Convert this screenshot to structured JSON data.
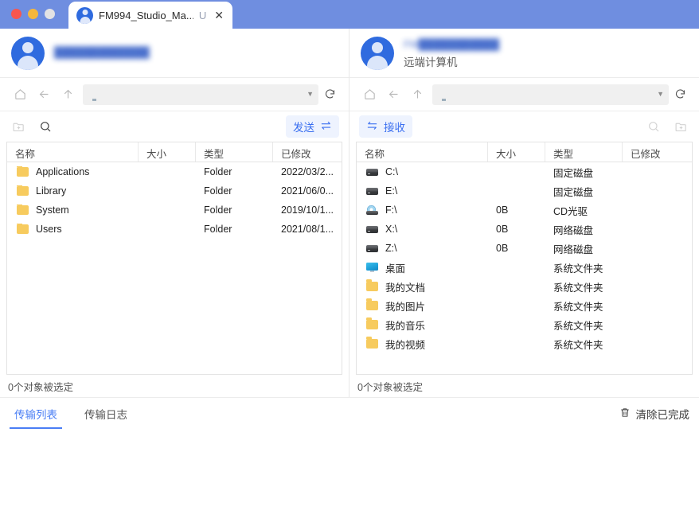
{
  "window": {
    "traffic_lights": [
      "close",
      "minimize",
      "maximize"
    ],
    "tab": {
      "title": "FM994_Studio_Ma...",
      "suffix": "U",
      "close_label": "✕",
      "avatar_icon": "user-avatar-icon"
    },
    "titlebar_color": "#6f8ee0"
  },
  "left_panel": {
    "account": {
      "name_blurred": "█████████████",
      "subtitle": ""
    },
    "nav": {
      "home_icon": "home-icon",
      "back_icon": "back-arrow-icon",
      "up_icon": "up-arrow-icon",
      "path_value": "",
      "path_icon": "monitor-icon",
      "caret_icon": "chevron-down-icon",
      "refresh_icon": "refresh-icon"
    },
    "actions": {
      "new_folder_icon": "new-folder-icon",
      "search_icon": "search-icon",
      "transfer_label": "发送",
      "transfer_icon": "transfer-right-icon"
    },
    "columns": [
      "名称",
      "大小",
      "类型",
      "已修改"
    ],
    "rows": [
      {
        "icon": "folder-icon",
        "name": "Applications",
        "size": "",
        "type": "Folder",
        "modified": "2022/03/2..."
      },
      {
        "icon": "folder-icon",
        "name": "Library",
        "size": "",
        "type": "Folder",
        "modified": "2021/06/0..."
      },
      {
        "icon": "folder-icon",
        "name": "System",
        "size": "",
        "type": "Folder",
        "modified": "2019/10/1..."
      },
      {
        "icon": "folder-icon",
        "name": "Users",
        "size": "",
        "type": "Folder",
        "modified": "2021/08/1..."
      }
    ],
    "status": "0个对象被选定"
  },
  "right_panel": {
    "account": {
      "name_blurred": "FM███████████",
      "subtitle": "远端计算机"
    },
    "nav": {
      "home_icon": "home-icon",
      "back_icon": "back-arrow-icon",
      "up_icon": "up-arrow-icon",
      "path_value": "",
      "path_icon": "monitor-icon",
      "caret_icon": "chevron-down-icon",
      "refresh_icon": "refresh-icon"
    },
    "actions": {
      "transfer_label": "接收",
      "transfer_icon": "transfer-left-icon",
      "search_icon": "search-icon",
      "new_folder_icon": "new-folder-icon"
    },
    "columns": [
      "名称",
      "大小",
      "类型",
      "已修改"
    ],
    "rows": [
      {
        "icon": "drive-icon",
        "name": "C:\\",
        "size": "",
        "type": "固定磁盘",
        "modified": ""
      },
      {
        "icon": "drive-icon",
        "name": "E:\\",
        "size": "",
        "type": "固定磁盘",
        "modified": ""
      },
      {
        "icon": "cd-icon",
        "name": "F:\\",
        "size": "0B",
        "type": "CD光驱",
        "modified": ""
      },
      {
        "icon": "drive-icon",
        "name": "X:\\",
        "size": "0B",
        "type": "网络磁盘",
        "modified": ""
      },
      {
        "icon": "drive-icon",
        "name": "Z:\\",
        "size": "0B",
        "type": "网络磁盘",
        "modified": ""
      },
      {
        "icon": "desktop-icon",
        "name": "桌面",
        "size": "",
        "type": "系统文件夹",
        "modified": ""
      },
      {
        "icon": "folder-icon",
        "name": "我的文档",
        "size": "",
        "type": "系统文件夹",
        "modified": ""
      },
      {
        "icon": "folder-icon",
        "name": "我的图片",
        "size": "",
        "type": "系统文件夹",
        "modified": ""
      },
      {
        "icon": "folder-icon",
        "name": "我的音乐",
        "size": "",
        "type": "系统文件夹",
        "modified": ""
      },
      {
        "icon": "folder-icon",
        "name": "我的视频",
        "size": "",
        "type": "系统文件夹",
        "modified": ""
      }
    ],
    "status": "0个对象被选定"
  },
  "bottom": {
    "tabs": [
      {
        "label": "传输列表",
        "active": true
      },
      {
        "label": "传输日志",
        "active": false
      }
    ],
    "clear_label": "清除已完成",
    "clear_icon": "trash-icon"
  },
  "colors": {
    "titlebar": "#6f8ee0",
    "accent": "#4a7ef5",
    "button_bg": "#eef3fe",
    "button_text": "#3a6ff0",
    "folder": "#f7cb5e"
  }
}
